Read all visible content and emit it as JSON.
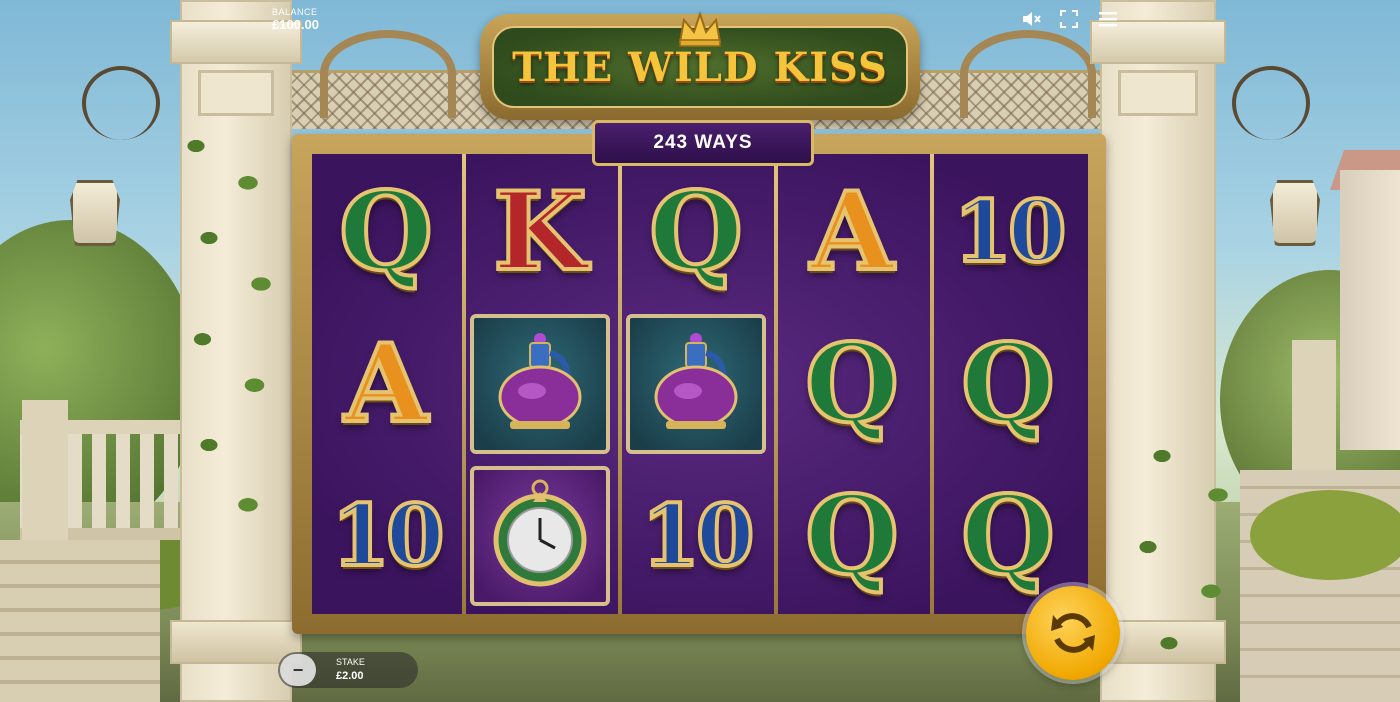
{
  "game": {
    "title": "THE WILD KISS",
    "ways_label": "243 WAYS"
  },
  "balance": {
    "label": "BALANCE",
    "value": "£100.00"
  },
  "stake": {
    "label": "STAKE",
    "value": "£2.00",
    "decrease_label": "−"
  },
  "controls": {
    "sound_icon": "speaker-muted-icon",
    "fullscreen_icon": "fullscreen-icon",
    "menu_icon": "hamburger-menu-icon",
    "spin_icon": "spin-arrows-icon"
  },
  "reels": [
    [
      {
        "symbol": "Q",
        "color": "#1f7a3a"
      },
      {
        "symbol": "A",
        "color": "#e8911e"
      },
      {
        "symbol": "10",
        "color": "#1f4a9c"
      }
    ],
    [
      {
        "symbol": "K",
        "color": "#b3262a"
      },
      {
        "symbol": "potion",
        "color": "#7a2a8c"
      },
      {
        "symbol": "watch",
        "color": "#6a2a8c"
      }
    ],
    [
      {
        "symbol": "Q",
        "color": "#1f7a3a"
      },
      {
        "symbol": "potion",
        "color": "#7a2a8c"
      },
      {
        "symbol": "10",
        "color": "#1f4a9c"
      }
    ],
    [
      {
        "symbol": "A",
        "color": "#e8911e"
      },
      {
        "symbol": "Q",
        "color": "#1f7a3a"
      },
      {
        "symbol": "Q",
        "color": "#1f7a3a"
      }
    ],
    [
      {
        "symbol": "10",
        "color": "#1f4a9c"
      },
      {
        "symbol": "Q",
        "color": "#1f7a3a"
      },
      {
        "symbol": "Q",
        "color": "#1f7a3a"
      }
    ]
  ],
  "colors": {
    "spin_button": "#f0a800",
    "reel_background": "#3b145e",
    "frame_gold": "#c8a55c"
  }
}
